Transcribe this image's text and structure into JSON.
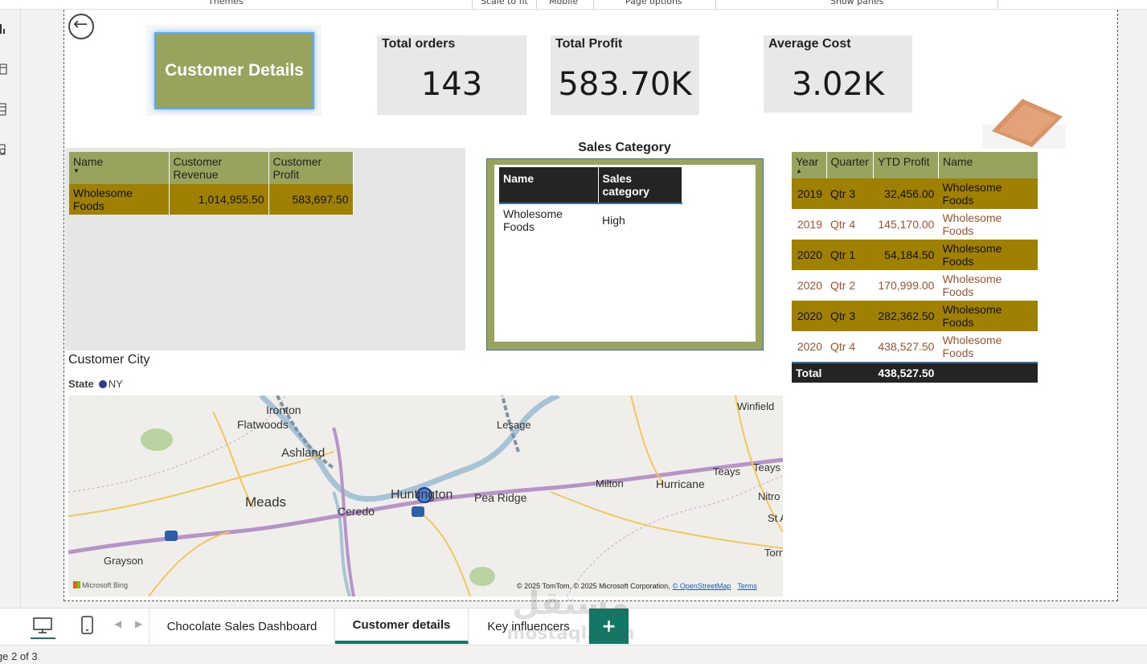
{
  "ribbon": {
    "items": [
      "Themes",
      "Scale to fit",
      "Mobile",
      "Page options",
      "Show panes"
    ]
  },
  "report": {
    "title_button": "Customer Details",
    "kpis": [
      {
        "label": "Total orders",
        "value": "143"
      },
      {
        "label": "Total Profit",
        "value": "583.70K"
      },
      {
        "label": "Average Cost",
        "value": "3.02K"
      }
    ]
  },
  "customer_table": {
    "headers": [
      "Name",
      "Customer Revenue",
      "Customer Profit"
    ],
    "rows": [
      [
        "Wholesome Foods",
        "1,014,955.50",
        "583,697.50"
      ]
    ]
  },
  "sales_category": {
    "title": "Sales Category",
    "headers": [
      "Name",
      "Sales category"
    ],
    "rows": [
      [
        "Wholesome Foods",
        "High"
      ]
    ]
  },
  "ytd_table": {
    "headers": [
      "Year",
      "Quarter",
      "YTD Profit",
      "Name"
    ],
    "rows": [
      [
        "2019",
        "Qtr 3",
        "32,456.00",
        "Wholesome Foods"
      ],
      [
        "2019",
        "Qtr 4",
        "145,170.00",
        "Wholesome Foods"
      ],
      [
        "2020",
        "Qtr 1",
        "54,184.50",
        "Wholesome Foods"
      ],
      [
        "2020",
        "Qtr 2",
        "170,999.00",
        "Wholesome Foods"
      ],
      [
        "2020",
        "Qtr 3",
        "282,362.50",
        "Wholesome Foods"
      ],
      [
        "2020",
        "Qtr 4",
        "438,527.50",
        "Wholesome Foods"
      ]
    ],
    "total_label": "Total",
    "total_value": "438,527.50"
  },
  "map": {
    "title": "Customer City",
    "legend_label": "State",
    "legend_value": "NY",
    "legend_color": "#2e3a8c",
    "cities": [
      "Ironton",
      "Flatwoods",
      "Lesage",
      "Winfield",
      "Ashland",
      "Teays",
      "Teays",
      "Milton",
      "Hurricane",
      "Huntington",
      "Pea Ridge",
      "Meads",
      "Ceredo",
      "Nitro",
      "St A",
      "Torn",
      "Grayson"
    ],
    "copyright": "© 2025 TomTom, © 2025 Microsoft Corporation,",
    "osm_link": "© OpenStreetMap",
    "terms_link": "Terms",
    "provider": "Microsoft Bing"
  },
  "tabs": {
    "pages": [
      "Chocolate Sales Dashboard",
      "Customer details",
      "Key influencers"
    ],
    "active": "Customer details",
    "add_label": "+"
  },
  "status": {
    "page_indicator": "ge 2 of 3"
  },
  "watermark": {
    "top": "مستقل",
    "bottom": "mostaql.com"
  },
  "colors": {
    "olive": "#98a35e",
    "gold": "#a08000",
    "accent": "#117865",
    "dark": "#252423"
  }
}
